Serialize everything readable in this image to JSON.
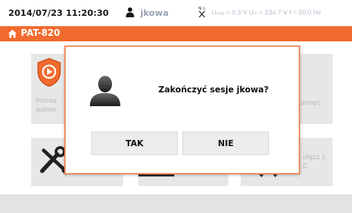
{
  "status": {
    "datetime": "2014/07/23 11:20:30",
    "user": "jkowa",
    "measurements": "Uₙₚₑ = 0.3 V  Uₗₙ = 234.7 V  f = 50.0 Hz"
  },
  "title_bar": {
    "device_name": "PAT-820"
  },
  "tiles": {
    "auto_measurement_label_line1": "Pomia",
    "auto_measurement_label_line2": "autom",
    "memory_label": "amięć",
    "pc_label_line1": "ołącz z",
    "pc_label_line2": "C"
  },
  "dialog": {
    "message": "Zakończyć sesje jkowa?",
    "yes_label": "TAK",
    "no_label": "NIE"
  },
  "colors": {
    "accent": "#f26a2e",
    "dialog_border": "#f08a5a",
    "tile_background": "#e7e7e7",
    "button_background": "#ececec"
  },
  "icons": {
    "user": "user-icon",
    "plug": "plug-icon",
    "home": "home-icon",
    "avatar": "user-avatar-icon",
    "auto_measure": "shield-play-icon",
    "settings": "tools-icon"
  }
}
